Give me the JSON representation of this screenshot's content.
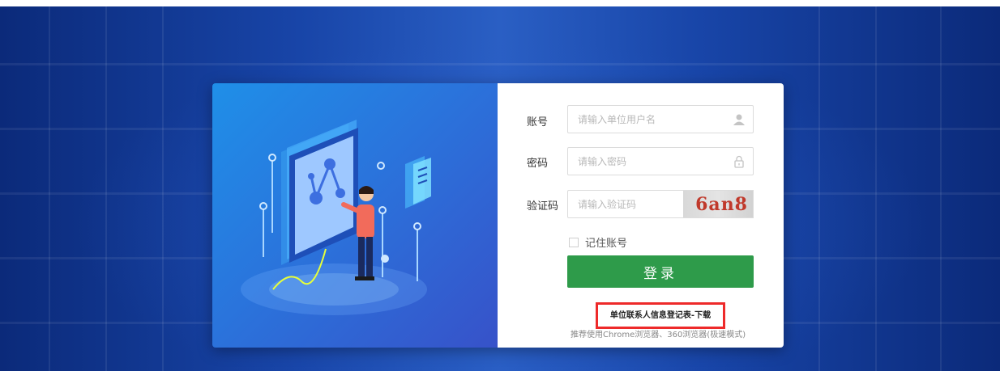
{
  "form": {
    "account_label": "账号",
    "account_placeholder": "请输入单位用户名",
    "password_label": "密码",
    "password_placeholder": "请输入密码",
    "captcha_label": "验证码",
    "captcha_placeholder": "请输入验证码",
    "captcha_text": "6an8",
    "remember_label": "记住账号",
    "login_label": "登录"
  },
  "footer": {
    "download_link": "单位联系人信息登记表-下载",
    "browser_tip": "推荐使用Chrome浏览器、360浏览器(极速模式)"
  },
  "icons": {
    "user": "user-icon",
    "lock": "lock-icon"
  },
  "colors": {
    "login_button": "#2e9b4a",
    "highlight_border": "#ee2a2a",
    "captcha_text": "#c0392b"
  }
}
